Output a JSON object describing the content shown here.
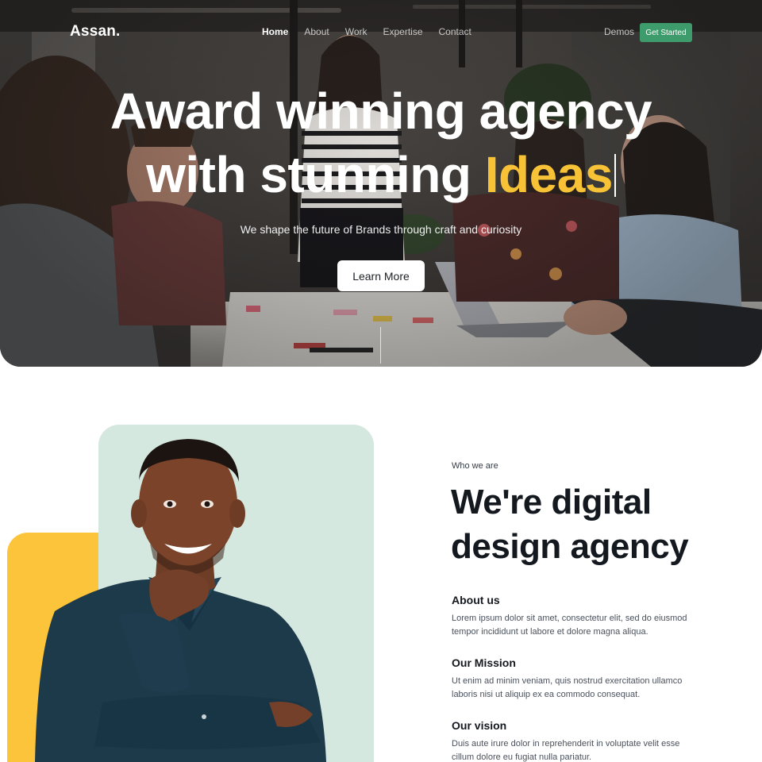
{
  "nav": {
    "logo": "Assan.",
    "links": [
      "Home",
      "About",
      "Work",
      "Expertise",
      "Contact"
    ],
    "demos": "Demos",
    "cta": "Get Started"
  },
  "hero": {
    "headline_line1": "Award winning agency",
    "headline_line2_prefix": "with stunning ",
    "headline_highlight": "Ideas",
    "subline": "We shape the future of Brands through craft and curiosity",
    "button": "Learn More",
    "accent_color": "#f7c236"
  },
  "about": {
    "eyebrow": "Who we are",
    "title_line1": "We're digital",
    "title_line2": "design agency",
    "blocks": [
      {
        "title": "About us",
        "line1": "Lorem ipsum dolor sit amet, consectetur elit, sed do eiusmod",
        "line2": "tempor incididunt ut labore et dolore magna aliqua."
      },
      {
        "title": "Our Mission",
        "line1": "Ut enim ad minim veniam, quis nostrud exercitation ullamco",
        "line2": "laboris nisi ut aliquip ex ea commodo consequat."
      },
      {
        "title": "Our vision",
        "line1": "Duis aute irure dolor in reprehenderit in voluptate velit esse",
        "line2": "cillum dolore eu fugiat nulla pariatur."
      }
    ]
  },
  "colors": {
    "brand_green": "#3e9b6b",
    "accent_yellow": "#fbc43a",
    "mint": "#d5e8df"
  }
}
